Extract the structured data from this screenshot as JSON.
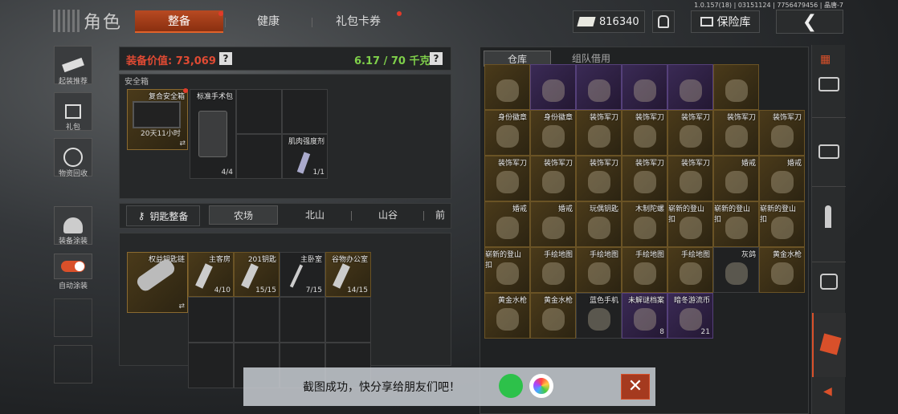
{
  "version_line": "1.0.157(18) | 03151124 | 7756479456 | 晶唐-7",
  "header": {
    "title": "角色",
    "tabs": [
      {
        "label": "整备",
        "active": true,
        "dot": true
      },
      {
        "label": "健康",
        "active": false,
        "dot": false
      },
      {
        "label": "礼包卡券",
        "active": false,
        "dot": true
      }
    ],
    "currency": "816340",
    "vault_label": "保险库"
  },
  "left_nav": [
    {
      "label": "起装推荐",
      "icon": "gun-icon"
    },
    {
      "label": "礼包",
      "icon": "gift-icon"
    },
    {
      "label": "物资回收",
      "icon": "recycle-icon"
    },
    {
      "label": "装备涂装",
      "icon": "helmet-icon"
    },
    {
      "label": "自动涂装",
      "icon": "toggle-icon"
    }
  ],
  "equip": {
    "value_label": "装备价值: 73,069",
    "weight": "6.17 / 70 千克",
    "help": "?"
  },
  "safe_box": {
    "section_title": "安全箱",
    "slots": [
      {
        "name": "复合安全箱",
        "timer": "20天11小时",
        "dot": true
      },
      {
        "name": "标准手术包",
        "count": "4/4"
      },
      {
        "name": "",
        "count": ""
      },
      {
        "name": "",
        "count": ""
      },
      {
        "name": "肌肉强度剂",
        "count": "1/1"
      }
    ]
  },
  "keys": {
    "button": "钥匙整备",
    "tabs": [
      "农场",
      "北山",
      "山谷",
      "前"
    ],
    "slots": [
      {
        "name": "权益钥匙链"
      },
      {
        "name": "主客房",
        "count": "4/10"
      },
      {
        "name": "201钥匙",
        "count": "15/15"
      },
      {
        "name": "主卧室",
        "count": "7/15"
      },
      {
        "name": "谷物办公室",
        "count": "14/15"
      }
    ]
  },
  "warehouse": {
    "tabs": [
      "仓库",
      "组队借用"
    ],
    "rows": [
      [
        {
          "n": "",
          "t": "gold"
        },
        {
          "n": "",
          "t": "purple"
        },
        {
          "n": "",
          "t": "purple"
        },
        {
          "n": "",
          "t": "purple"
        },
        {
          "n": "",
          "t": "purple"
        },
        {
          "n": "",
          "t": "gold"
        }
      ],
      [
        {
          "n": "身份徽章",
          "t": "gold"
        },
        {
          "n": "身份徽章",
          "t": "gold"
        },
        {
          "n": "装饰军刀",
          "t": "gold"
        },
        {
          "n": "装饰军刀",
          "t": "gold"
        },
        {
          "n": "装饰军刀",
          "t": "gold"
        },
        {
          "n": "装饰军刀",
          "t": "gold"
        },
        {
          "n": "装饰军刀",
          "t": "gold"
        }
      ],
      [
        {
          "n": "装饰军刀",
          "t": "gold"
        },
        {
          "n": "装饰军刀",
          "t": "gold"
        },
        {
          "n": "装饰军刀",
          "t": "gold"
        },
        {
          "n": "装饰军刀",
          "t": "gold"
        },
        {
          "n": "装饰军刀",
          "t": "gold"
        },
        {
          "n": "婚戒",
          "t": "gold"
        },
        {
          "n": "婚戒",
          "t": "gold"
        }
      ],
      [
        {
          "n": "婚戒",
          "t": "gold"
        },
        {
          "n": "婚戒",
          "t": "gold"
        },
        {
          "n": "玩偶钥匙",
          "t": "gold"
        },
        {
          "n": "木制陀螺",
          "t": "gold"
        },
        {
          "n": "崭新的登山扣",
          "t": "gold"
        },
        {
          "n": "崭新的登山扣",
          "t": "gold"
        },
        {
          "n": "崭新的登山扣",
          "t": "gold"
        }
      ],
      [
        {
          "n": "崭新的登山扣",
          "t": "gold"
        },
        {
          "n": "手绘地图",
          "t": "gold"
        },
        {
          "n": "手绘地图",
          "t": "gold"
        },
        {
          "n": "手绘地图",
          "t": "gold"
        },
        {
          "n": "手绘地图",
          "t": "gold"
        },
        {
          "n": "灰鸽",
          "t": "dk"
        },
        {
          "n": "黄金水枪",
          "t": "gold"
        }
      ],
      [
        {
          "n": "黄金水枪",
          "t": "gold"
        },
        {
          "n": "黄金水枪",
          "t": "gold"
        },
        {
          "n": "蓝色手机",
          "t": "dk"
        },
        {
          "n": "未解谜档案",
          "t": "purple",
          "c": "8"
        },
        {
          "n": "暗冬游流币",
          "t": "purple",
          "c": "21"
        }
      ]
    ]
  },
  "toast": {
    "text": "截图成功，快分享给朋友们吧！"
  },
  "colors": {
    "accent": "#d9502a",
    "gold": "#6a5325",
    "purple": "#55407a"
  }
}
